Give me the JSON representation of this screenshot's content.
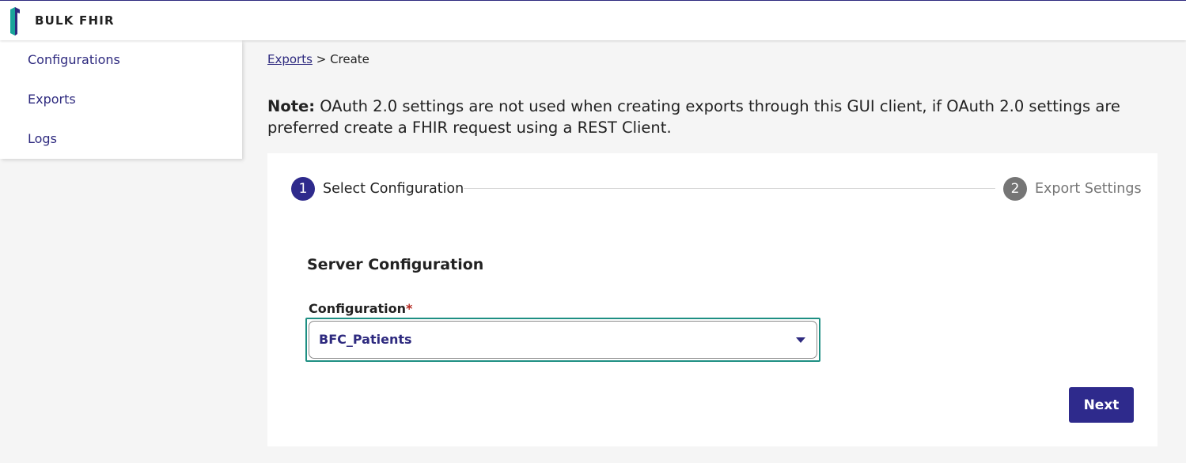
{
  "header": {
    "title": "BULK FHIR",
    "logo_icon": "bulk-fhir-logo"
  },
  "sidebar": {
    "items": [
      {
        "label": "Configurations"
      },
      {
        "label": "Exports"
      },
      {
        "label": "Logs"
      }
    ]
  },
  "breadcrumb": {
    "link": "Exports",
    "separator": ">",
    "current": "Create"
  },
  "note": {
    "prefix": "Note:",
    "text": "OAuth 2.0 settings are not used when creating exports through this GUI client, if OAuth 2.0 settings are preferred create a FHIR request using a REST Client."
  },
  "stepper": {
    "steps": [
      {
        "number": "1",
        "label": "Select Configuration",
        "active": true
      },
      {
        "number": "2",
        "label": "Export Settings",
        "active": false
      }
    ]
  },
  "form": {
    "section_title": "Server Configuration",
    "field_label": "Configuration",
    "required_mark": "*",
    "selected_value": "BFC_Patients"
  },
  "actions": {
    "next_label": "Next"
  },
  "colors": {
    "primary": "#2e2a8c",
    "focus_ring": "#1e8f83",
    "inactive_step": "#757575",
    "required": "#b3261e",
    "logo_teal": "#1aa39a"
  }
}
